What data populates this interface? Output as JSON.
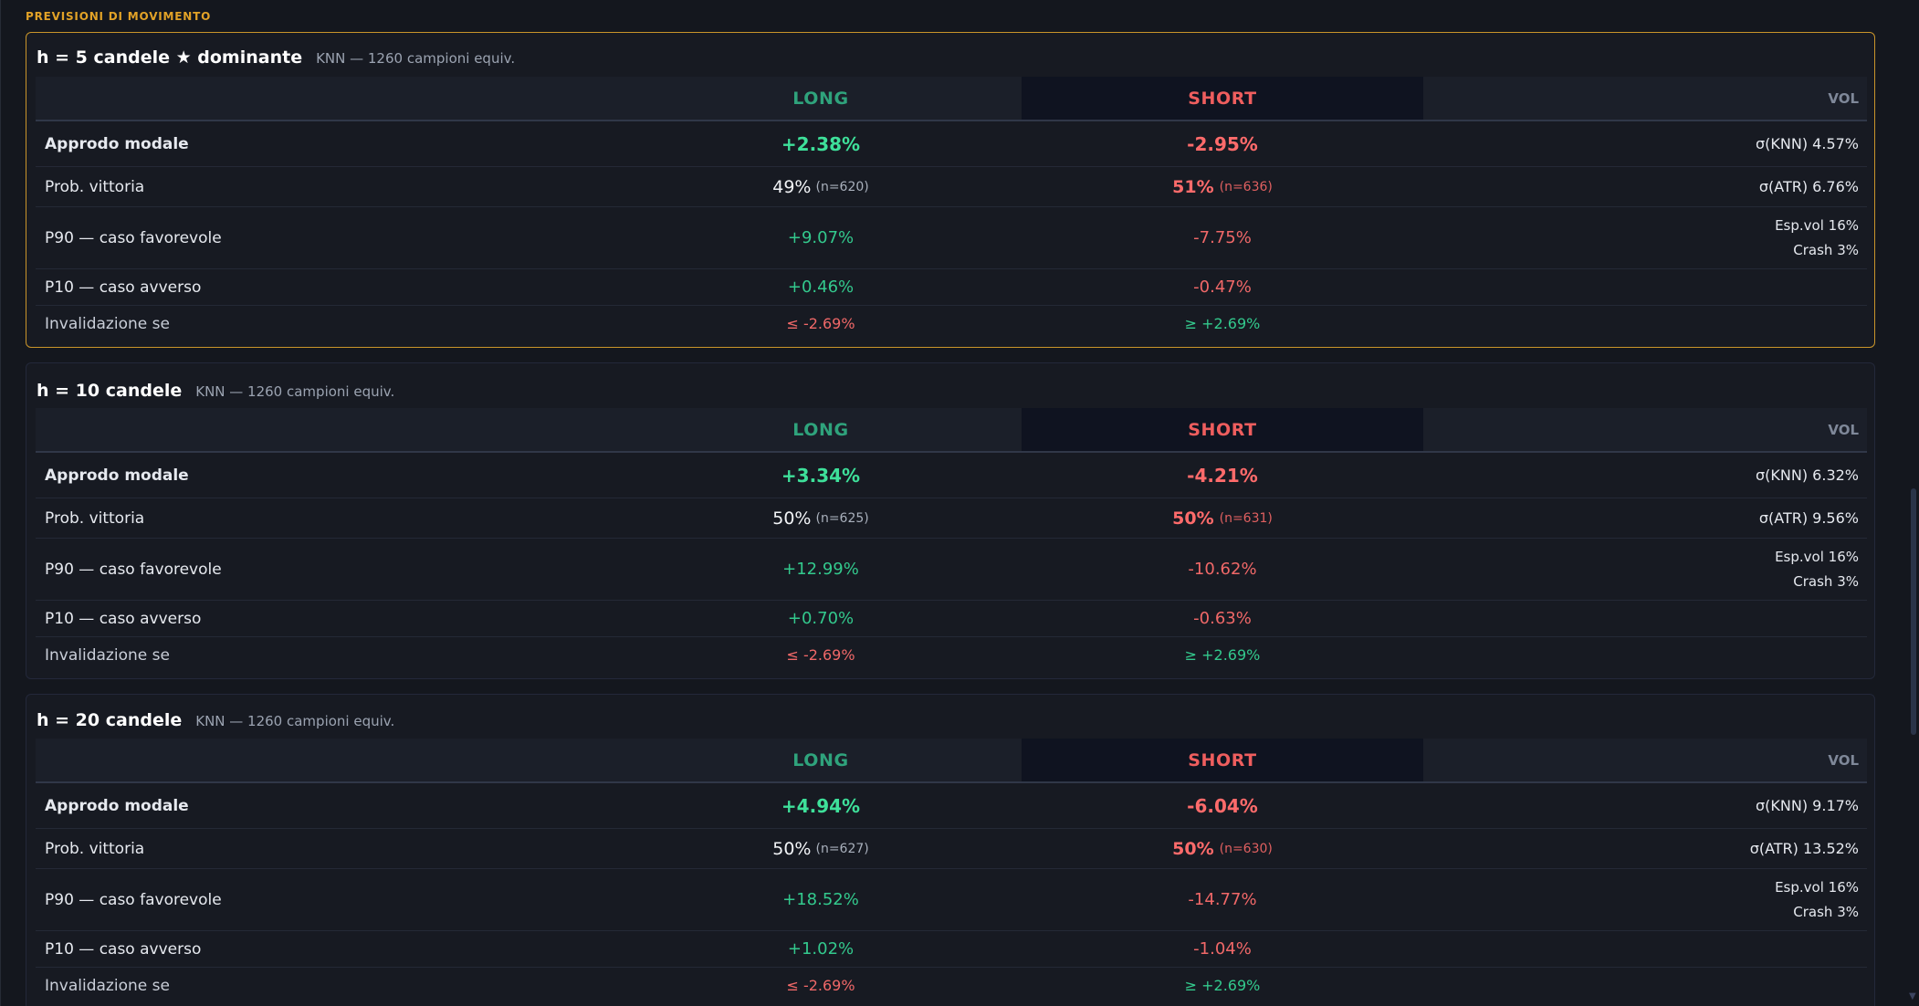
{
  "section_title": "PREVISIONI DI MOVIMENTO",
  "headers": {
    "long": "LONG",
    "short": "SHORT",
    "vol": "VOL"
  },
  "row_labels": {
    "approdo": "Approdo modale",
    "prob": "Prob. vittoria",
    "p90": "P90 — caso favorevole",
    "p10": "P10 — caso avverso",
    "inval": "Invalidazione se"
  },
  "colors": {
    "accent": "#e2a227",
    "long": "#2fa37c",
    "short": "#ef5e5e"
  },
  "horizons": [
    {
      "title": "h = 5 candele ★ dominante",
      "subtitle": "KNN — 1260 campioni equiv.",
      "approdo_long": "+2.38%",
      "approdo_short": "-2.95%",
      "vol1": "σ(KNN) 4.57%",
      "prob_long": "49%",
      "prob_long_n": "(n=620)",
      "prob_short": "51%",
      "prob_short_n": "(n=636)",
      "vol2": "σ(ATR) 6.76%",
      "p90_long": "+9.07%",
      "p90_short": "-7.75%",
      "esp": "Esp.vol 16%",
      "crash": "Crash 3%",
      "p10_long": "+0.46%",
      "p10_short": "-0.47%",
      "inval_long": "≤ -2.69%",
      "inval_short": "≥ +2.69%"
    },
    {
      "title": "h = 10 candele",
      "subtitle": "KNN — 1260 campioni equiv.",
      "approdo_long": "+3.34%",
      "approdo_short": "-4.21%",
      "vol1": "σ(KNN) 6.32%",
      "prob_long": "50%",
      "prob_long_n": "(n=625)",
      "prob_short": "50%",
      "prob_short_n": "(n=631)",
      "vol2": "σ(ATR) 9.56%",
      "p90_long": "+12.99%",
      "p90_short": "-10.62%",
      "esp": "Esp.vol 16%",
      "crash": "Crash 3%",
      "p10_long": "+0.70%",
      "p10_short": "-0.63%",
      "inval_long": "≤ -2.69%",
      "inval_short": "≥ +2.69%"
    },
    {
      "title": "h = 20 candele",
      "subtitle": "KNN — 1260 campioni equiv.",
      "approdo_long": "+4.94%",
      "approdo_short": "-6.04%",
      "vol1": "σ(KNN) 9.17%",
      "prob_long": "50%",
      "prob_long_n": "(n=627)",
      "prob_short": "50%",
      "prob_short_n": "(n=630)",
      "vol2": "σ(ATR) 13.52%",
      "p90_long": "+18.52%",
      "p90_short": "-14.77%",
      "esp": "Esp.vol 16%",
      "crash": "Crash 3%",
      "p10_long": "+1.02%",
      "p10_short": "-1.04%",
      "inval_long": "≤ -2.69%",
      "inval_short": "≥ +2.69%"
    }
  ]
}
